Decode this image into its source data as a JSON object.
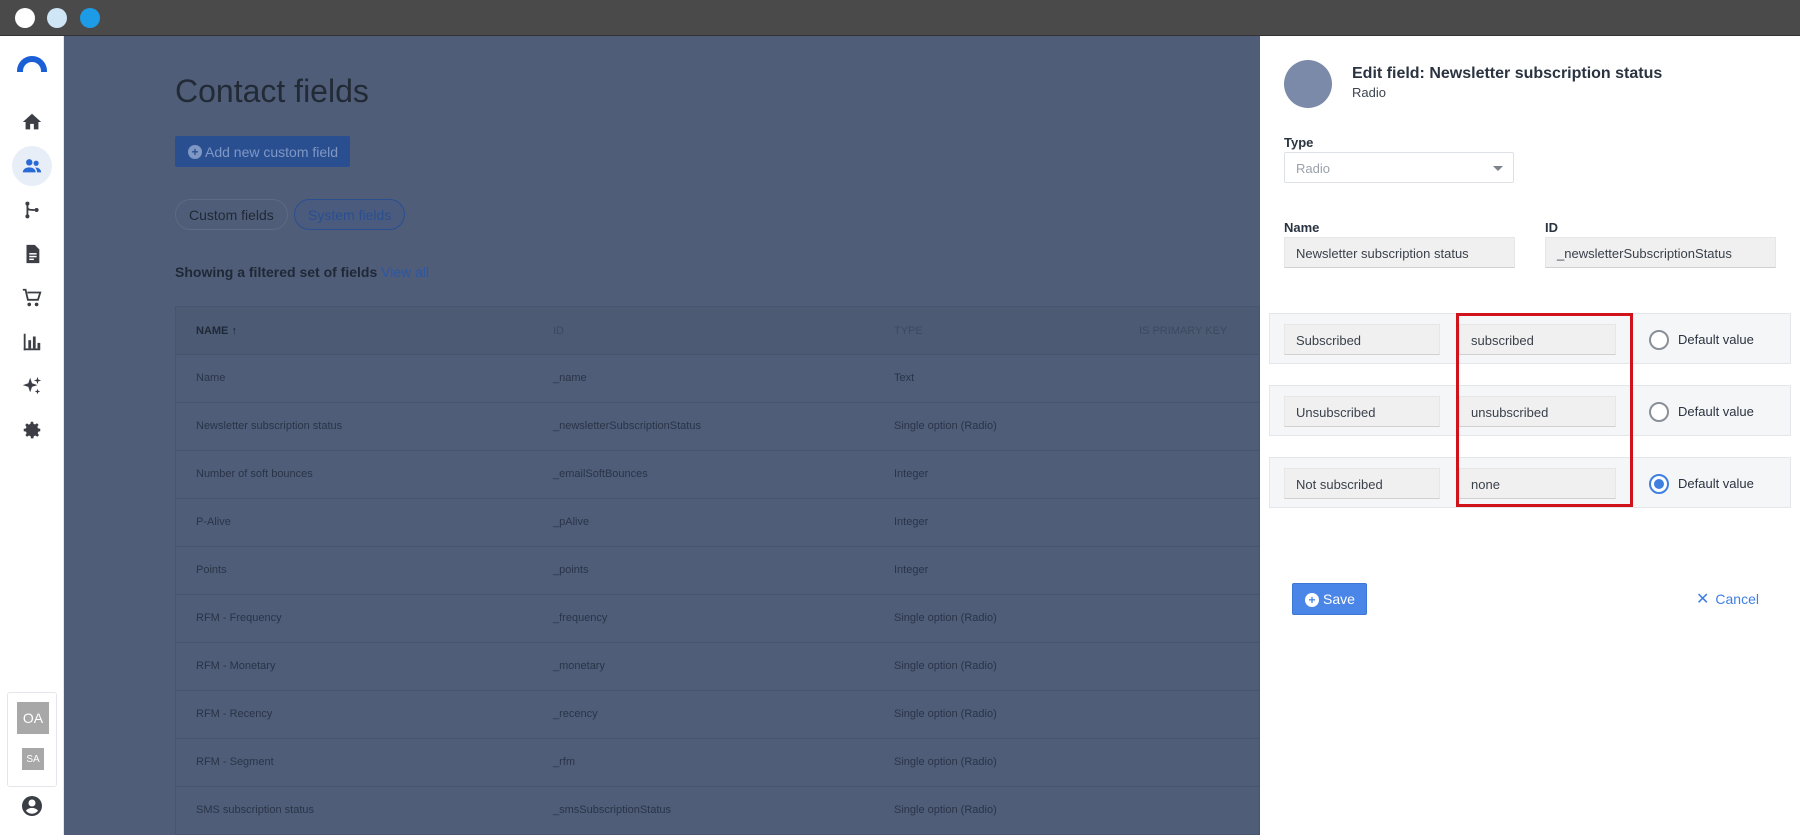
{
  "nav": {
    "items": [
      "home-icon",
      "contacts-icon",
      "automation-icon",
      "document-icon",
      "cart-icon",
      "analytics-icon",
      "ai-sparkle-icon",
      "settings-icon"
    ],
    "active": "contacts-icon",
    "user_initials": "OA",
    "secondary_initials": "SA"
  },
  "main": {
    "title": "Contact fields",
    "add_button": "Add new custom field",
    "tabs": [
      "Custom fields",
      "System fields"
    ],
    "active_tab": "System fields",
    "filter_text": "Showing a filtered set of fields",
    "view_all": "View all",
    "columns": [
      "NAME",
      "ID",
      "TYPE",
      "IS PRIMARY KEY"
    ],
    "sort_indicator": "↑",
    "rows": [
      {
        "name": "Name",
        "id": "_name",
        "type": "Text"
      },
      {
        "name": "Newsletter subscription status",
        "id": "_newsletterSubscriptionStatus",
        "type": "Single option (Radio)"
      },
      {
        "name": "Number of soft bounces",
        "id": "_emailSoftBounces",
        "type": "Integer"
      },
      {
        "name": "P-Alive",
        "id": "_pAlive",
        "type": "Integer"
      },
      {
        "name": "Points",
        "id": "_points",
        "type": "Integer"
      },
      {
        "name": "RFM - Frequency",
        "id": "_frequency",
        "type": "Single option (Radio)"
      },
      {
        "name": "RFM - Monetary",
        "id": "_monetary",
        "type": "Single option (Radio)"
      },
      {
        "name": "RFM - Recency",
        "id": "_recency",
        "type": "Single option (Radio)"
      },
      {
        "name": "RFM - Segment",
        "id": "_rfm",
        "type": "Single option (Radio)"
      },
      {
        "name": "SMS subscription status",
        "id": "_smsSubscriptionStatus",
        "type": "Single option (Radio)"
      }
    ]
  },
  "panel": {
    "title": "Edit field: Newsletter subscription status",
    "subtitle": "Radio",
    "type_label": "Type",
    "type_value": "Radio",
    "name_label": "Name",
    "name_value": "Newsletter subscription status",
    "id_label": "ID",
    "id_value": "_newsletterSubscriptionStatus",
    "options": [
      {
        "label": "Subscribed",
        "value": "subscribed",
        "default_label": "Default value",
        "is_default": false
      },
      {
        "label": "Unsubscribed",
        "value": "unsubscribed",
        "default_label": "Default value",
        "is_default": false
      },
      {
        "label": "Not subscribed",
        "value": "none",
        "default_label": "Default value",
        "is_default": true
      }
    ],
    "save_label": "Save",
    "cancel_label": "Cancel"
  },
  "colors": {
    "accent": "#4a86e8",
    "highlight": "#d0121b",
    "overlay": "#4f5d78"
  }
}
